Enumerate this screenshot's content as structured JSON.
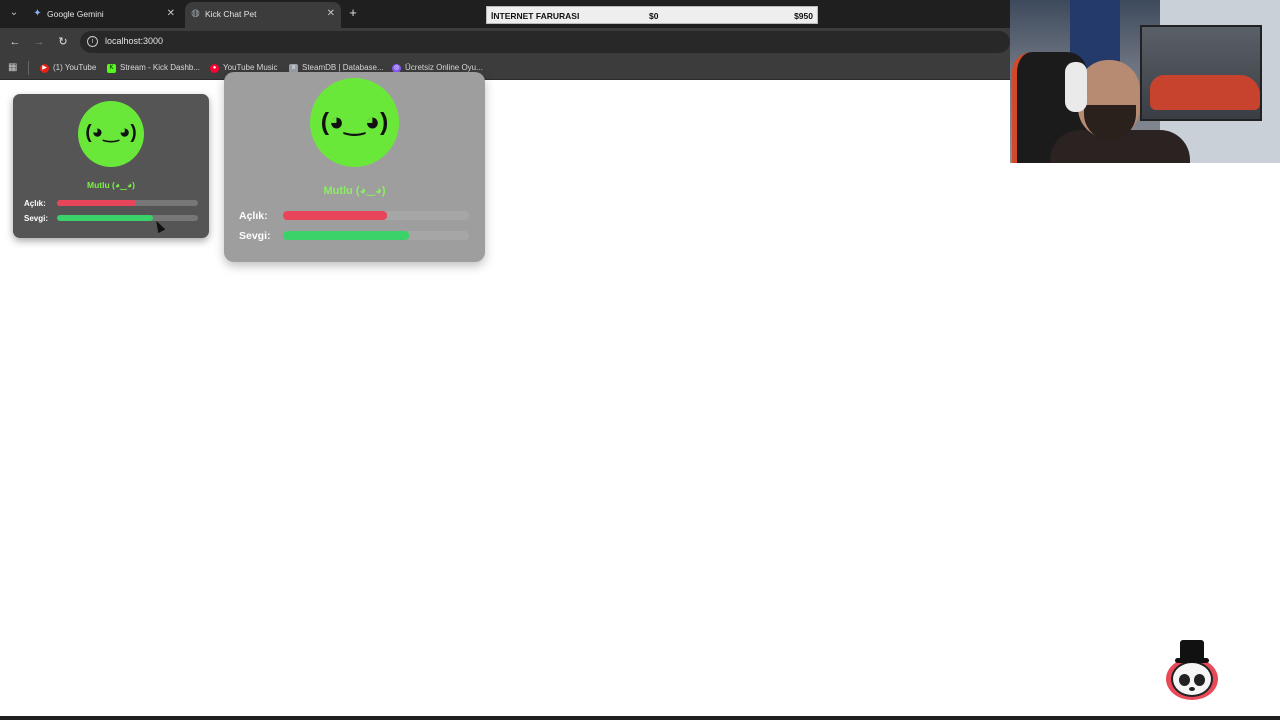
{
  "browser": {
    "tabs": [
      {
        "label": "Google Gemini",
        "icon": "gemini-icon",
        "active": false
      },
      {
        "label": "Kick Chat Pet",
        "icon": "globe-icon",
        "active": true
      }
    ],
    "url": "localhost:3000",
    "bookmarks": [
      {
        "label": "(1) YouTube",
        "icon": "youtube-icon",
        "color": "#e62117"
      },
      {
        "label": "Stream - Kick Dashb...",
        "icon": "kick-icon",
        "color": "#53fc18"
      },
      {
        "label": "YouTube Music",
        "icon": "youtube-music-icon",
        "color": "#ff0033"
      },
      {
        "label": "SteamDB | Database...",
        "icon": "steamdb-icon",
        "color": "#9aa0a6"
      },
      {
        "label": "Ücretsiz Online Oyu...",
        "icon": "game-icon",
        "color": "#8a5cf6"
      }
    ]
  },
  "overlay": {
    "title": "İNTERNET FARURASI",
    "current": "$0",
    "goal": "$950"
  },
  "pets": [
    {
      "face": "(◕‿◕)",
      "mood": "Mutlu (◕‿◕)",
      "stats": [
        {
          "label": "Açlık:",
          "value": 0.56,
          "color": "#e8455a"
        },
        {
          "label": "Sevgi:",
          "value": 0.68,
          "color": "#3ad36a"
        }
      ]
    },
    {
      "face": "(◕‿◕)",
      "mood": "Mutlu (◕‿◕)",
      "stats": [
        {
          "label": "Açlık:",
          "value": 0.56,
          "color": "#e8455a"
        },
        {
          "label": "Sevgi:",
          "value": 0.68,
          "color": "#3ad36a"
        }
      ]
    }
  ],
  "colors": {
    "face": "#6ae83a",
    "mood_text": "#7cf04a"
  }
}
